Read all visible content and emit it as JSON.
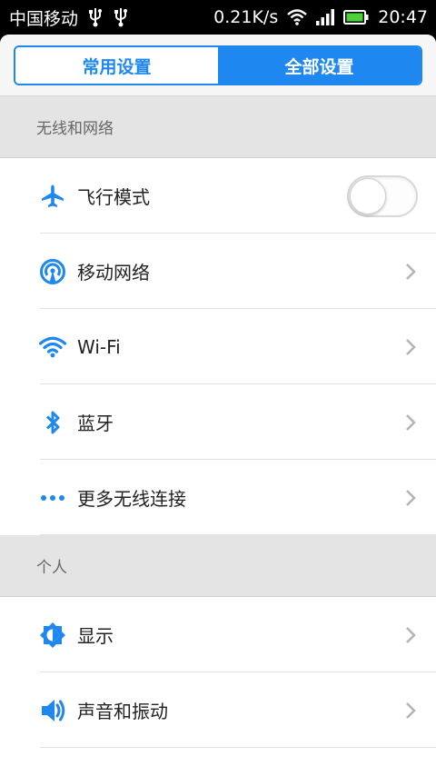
{
  "status_bar": {
    "carrier": "中国移动",
    "net_speed": "0.21K/s",
    "time": "20:47",
    "icons": [
      "usb-icon",
      "usb-icon",
      "wifi-signal-icon",
      "cell-signal-icon",
      "battery-icon"
    ]
  },
  "tabs": [
    {
      "label": "常用设置",
      "selected": false
    },
    {
      "label": "全部设置",
      "selected": true
    }
  ],
  "sections": [
    {
      "title": "无线和网络",
      "items": [
        {
          "label": "飞行模式",
          "icon": "airplane-icon",
          "control": "toggle",
          "on": false
        },
        {
          "label": "移动网络",
          "icon": "mobile-network-icon",
          "control": "chevron"
        },
        {
          "label": "Wi-Fi",
          "icon": "wifi-icon",
          "control": "chevron"
        },
        {
          "label": "蓝牙",
          "icon": "bluetooth-icon",
          "control": "chevron"
        },
        {
          "label": "更多无线连接",
          "icon": "more-dots-icon",
          "control": "chevron"
        }
      ]
    },
    {
      "title": "个人",
      "items": [
        {
          "label": "显示",
          "icon": "display-brightness-icon",
          "control": "chevron"
        },
        {
          "label": "声音和振动",
          "icon": "sound-icon",
          "control": "chevron"
        }
      ]
    }
  ],
  "colors": {
    "accent": "#1e88f0",
    "section_bg": "#e4e4e4",
    "status_bar_bg": "#000000"
  }
}
